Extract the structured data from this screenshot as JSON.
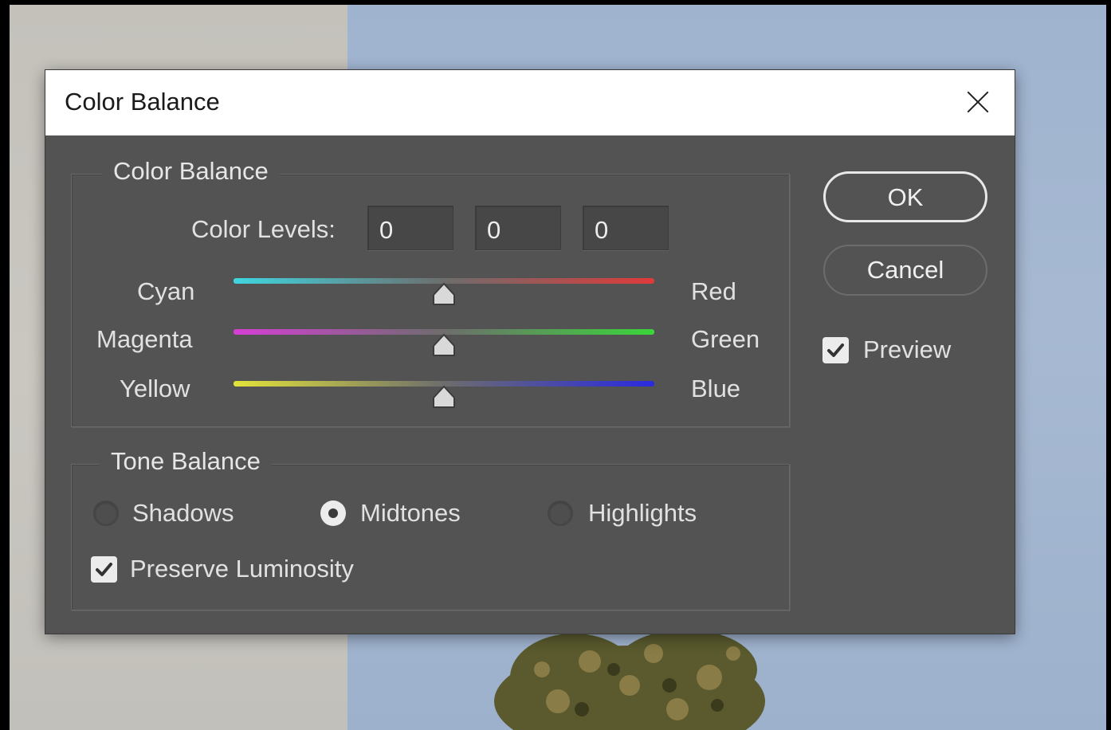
{
  "dialog": {
    "title": "Color Balance",
    "close_icon": "close-icon"
  },
  "color_balance": {
    "legend": "Color Balance",
    "color_levels_label": "Color Levels:",
    "levels": [
      "0",
      "0",
      "0"
    ],
    "sliders": [
      {
        "left": "Cyan",
        "right": "Red",
        "left_color": "#3fd6e0",
        "right_color": "#e03a3a",
        "value": 0,
        "min": -100,
        "max": 100
      },
      {
        "left": "Magenta",
        "right": "Green",
        "left_color": "#d63fd6",
        "right_color": "#3ad63a",
        "value": 0,
        "min": -100,
        "max": 100
      },
      {
        "left": "Yellow",
        "right": "Blue",
        "left_color": "#e3e33a",
        "right_color": "#2a2ae0",
        "value": 0,
        "min": -100,
        "max": 100
      }
    ]
  },
  "tone_balance": {
    "legend": "Tone Balance",
    "options": [
      {
        "label": "Shadows",
        "selected": false
      },
      {
        "label": "Midtones",
        "selected": true
      },
      {
        "label": "Highlights",
        "selected": false
      }
    ],
    "preserve_luminosity_label": "Preserve Luminosity",
    "preserve_luminosity_checked": true
  },
  "buttons": {
    "ok": "OK",
    "cancel": "Cancel"
  },
  "preview": {
    "label": "Preview",
    "checked": true
  },
  "colors": {
    "dialog_bg": "#535353",
    "titlebar_bg": "#ffffff",
    "text": "#e1e1e1"
  }
}
